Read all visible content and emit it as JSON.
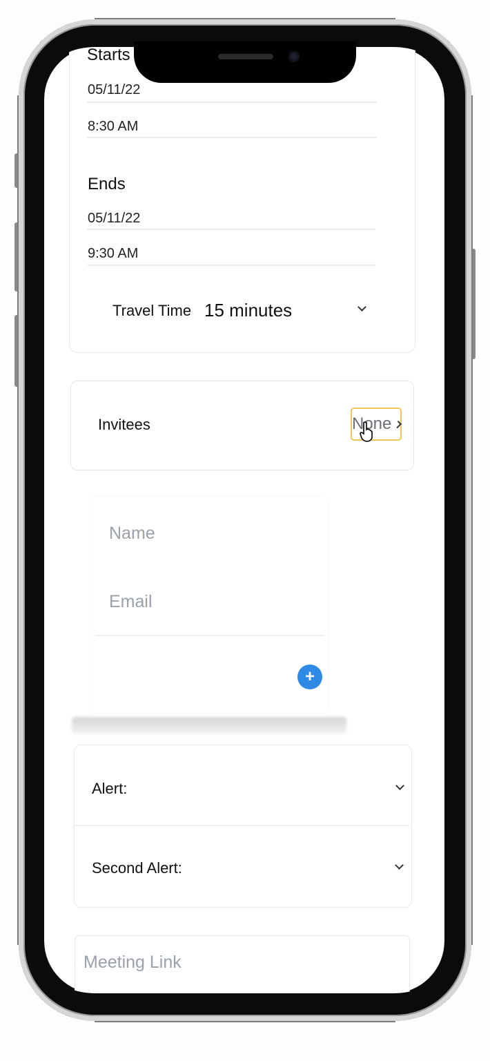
{
  "starts": {
    "label": "Starts",
    "date": "05/11/22",
    "time": "8:30 AM"
  },
  "ends": {
    "label": "Ends",
    "date": "05/11/22",
    "time": "9:30 AM"
  },
  "travel": {
    "label": "Travel Time",
    "value": "15 minutes"
  },
  "invitees": {
    "label": "Invitees",
    "value": "None"
  },
  "invitee_form": {
    "name_placeholder": "Name",
    "email_placeholder": "Email",
    "add_icon": "plus-icon"
  },
  "alerts": {
    "alert_label": "Alert:",
    "second_alert_label": "Second Alert:"
  },
  "meeting": {
    "placeholder": "Meeting Link"
  },
  "colors": {
    "accent": "#2f8ae6",
    "focus": "#f0c85a",
    "border": "#e4e8ee",
    "placeholder": "#9aa1ab"
  }
}
